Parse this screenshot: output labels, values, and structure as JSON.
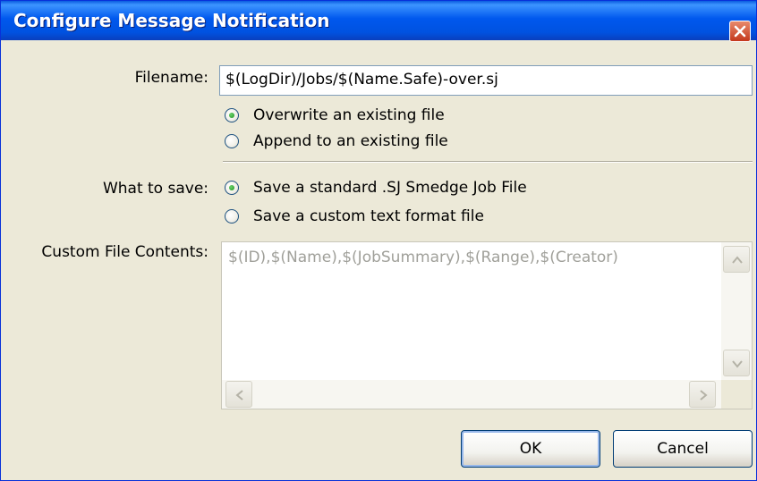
{
  "window": {
    "title": "Configure Message Notification"
  },
  "filename": {
    "label": "Filename:",
    "value": "$(LogDir)/Jobs/$(Name.Safe)-over.sj",
    "options": [
      {
        "label": "Overwrite an existing file",
        "checked": true
      },
      {
        "label": "Append to an existing file",
        "checked": false
      }
    ]
  },
  "what_to_save": {
    "label": "What to save:",
    "options": [
      {
        "label": "Save a standard .SJ Smedge Job File",
        "checked": true
      },
      {
        "label": "Save a custom text format file",
        "checked": false
      }
    ]
  },
  "custom_contents": {
    "label": "Custom File Contents:",
    "value": "$(ID),$(Name),$(JobSummary),$(Range),$(Creator)",
    "disabled": true
  },
  "buttons": {
    "ok": "OK",
    "cancel": "Cancel"
  },
  "icons": {
    "close": "close-icon",
    "scroll_up": "arrow-up-icon",
    "scroll_down": "arrow-down-icon",
    "scroll_left": "arrow-left-icon",
    "scroll_right": "arrow-right-icon"
  },
  "colors": {
    "titlebar": "#0058ee",
    "close_button": "#c4381c",
    "dialog_bg": "#ece9d8"
  }
}
